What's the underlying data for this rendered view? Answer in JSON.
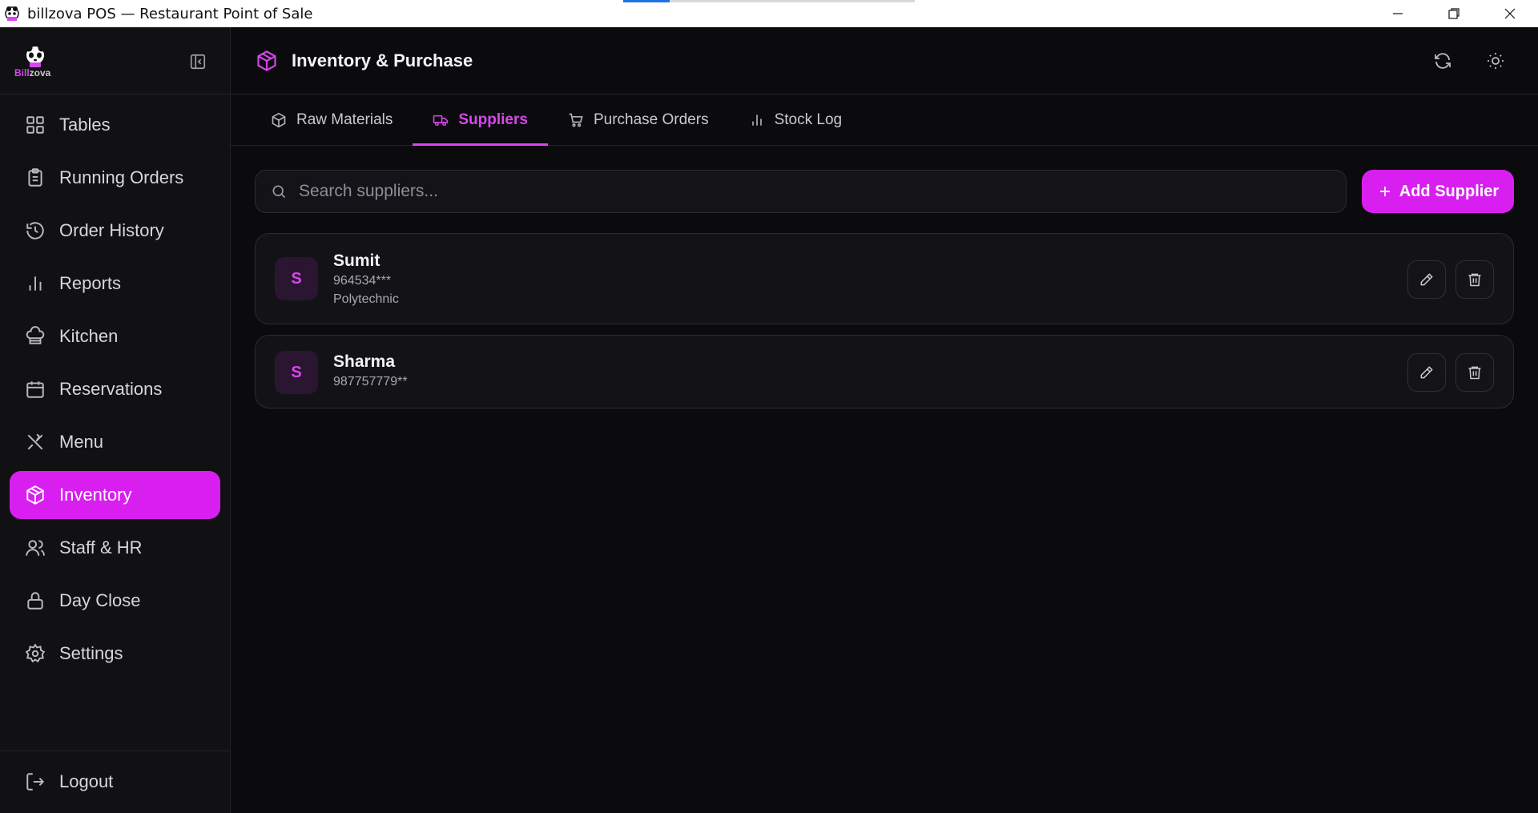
{
  "window": {
    "title": "billzova POS — Restaurant Point of Sale",
    "progress_fraction": 0.16
  },
  "brand": {
    "logo_text_a": "Bill",
    "logo_text_b": "zova"
  },
  "sidebar": {
    "items": [
      {
        "label": "Tables",
        "icon": "grid-icon"
      },
      {
        "label": "Running Orders",
        "icon": "clipboard-icon"
      },
      {
        "label": "Order History",
        "icon": "history-icon"
      },
      {
        "label": "Reports",
        "icon": "bar-chart-icon"
      },
      {
        "label": "Kitchen",
        "icon": "chef-hat-icon"
      },
      {
        "label": "Reservations",
        "icon": "calendar-icon"
      },
      {
        "label": "Menu",
        "icon": "utensils-icon"
      },
      {
        "label": "Inventory",
        "icon": "package-icon",
        "active": true
      },
      {
        "label": "Staff & HR",
        "icon": "users-icon"
      },
      {
        "label": "Day Close",
        "icon": "lock-icon"
      },
      {
        "label": "Settings",
        "icon": "gear-icon"
      }
    ],
    "logout_label": "Logout"
  },
  "header": {
    "title": "Inventory & Purchase"
  },
  "tabs": [
    {
      "label": "Raw Materials",
      "icon": "package-icon"
    },
    {
      "label": "Suppliers",
      "icon": "truck-icon",
      "active": true
    },
    {
      "label": "Purchase Orders",
      "icon": "cart-icon"
    },
    {
      "label": "Stock Log",
      "icon": "bar-chart-icon"
    }
  ],
  "search": {
    "placeholder": "Search suppliers...",
    "value": ""
  },
  "add_button": {
    "label": "Add Supplier"
  },
  "suppliers": [
    {
      "initial": "S",
      "name": "Sumit",
      "phone": "964534***",
      "address": "Polytechnic"
    },
    {
      "initial": "S",
      "name": "Sharma",
      "phone": "987757779**"
    }
  ],
  "colors": {
    "accent": "#d91ff0",
    "accent_text": "#d946ef",
    "background": "#0b0b0e",
    "sidebar": "#111114"
  }
}
